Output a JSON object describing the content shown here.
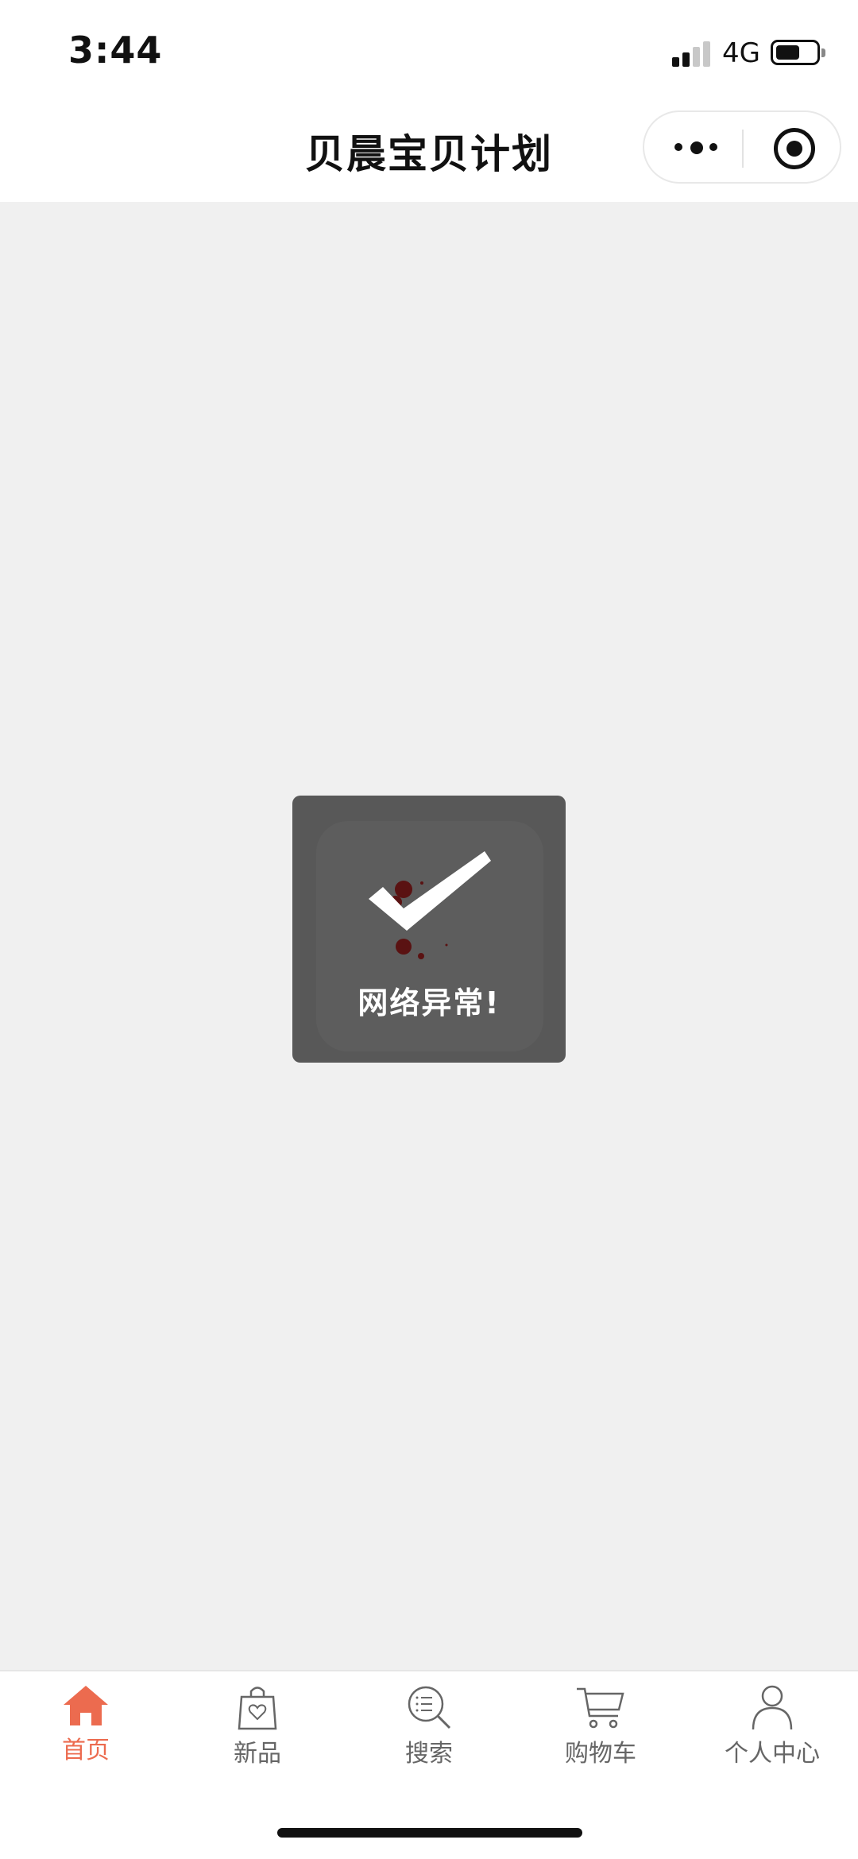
{
  "status_bar": {
    "time": "3:44",
    "network": "4G",
    "signal_bars_active": 2,
    "signal_bars_total": 4,
    "battery_level": 0.6
  },
  "nav": {
    "title": "贝晨宝贝计划",
    "more_icon": "more-dots-icon",
    "close_icon": "target-circle-icon"
  },
  "toast": {
    "icon": "checkmark-icon",
    "message": "网络异常!"
  },
  "tabs": [
    {
      "label": "首页",
      "icon": "home-icon",
      "active": true
    },
    {
      "label": "新品",
      "icon": "shopping-bag-heart-icon",
      "active": false
    },
    {
      "label": "搜索",
      "icon": "search-list-icon",
      "active": false
    },
    {
      "label": "购物车",
      "icon": "cart-icon",
      "active": false
    },
    {
      "label": "个人中心",
      "icon": "user-icon",
      "active": false
    }
  ],
  "colors": {
    "accent": "#ec6b4f",
    "tab_inactive": "#666666",
    "page_background": "#f0f0f0",
    "toast_background": "#585858"
  }
}
